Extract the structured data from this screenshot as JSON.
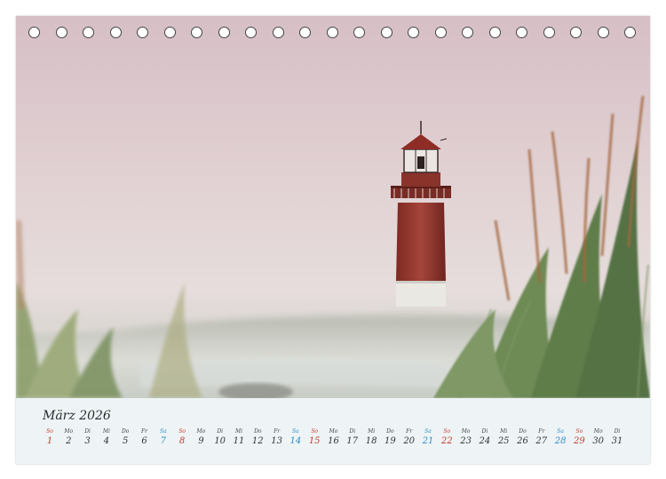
{
  "colors": {
    "saturday": "#2f8fc8",
    "sunday": "#c23a2e",
    "text": "#333333"
  },
  "calendar": {
    "title": "März 2026",
    "days": [
      {
        "wd": "So",
        "num": "1",
        "type": "so"
      },
      {
        "wd": "Mo",
        "num": "2",
        "type": "wk"
      },
      {
        "wd": "Di",
        "num": "3",
        "type": "wk"
      },
      {
        "wd": "Mi",
        "num": "4",
        "type": "wk"
      },
      {
        "wd": "Do",
        "num": "5",
        "type": "wk"
      },
      {
        "wd": "Fr",
        "num": "6",
        "type": "wk"
      },
      {
        "wd": "Sa",
        "num": "7",
        "type": "sa"
      },
      {
        "wd": "So",
        "num": "8",
        "type": "so"
      },
      {
        "wd": "Mo",
        "num": "9",
        "type": "wk"
      },
      {
        "wd": "Di",
        "num": "10",
        "type": "wk"
      },
      {
        "wd": "Mi",
        "num": "11",
        "type": "wk"
      },
      {
        "wd": "Do",
        "num": "12",
        "type": "wk"
      },
      {
        "wd": "Fr",
        "num": "13",
        "type": "wk"
      },
      {
        "wd": "Sa",
        "num": "14",
        "type": "sa"
      },
      {
        "wd": "So",
        "num": "15",
        "type": "so"
      },
      {
        "wd": "Mo",
        "num": "16",
        "type": "wk"
      },
      {
        "wd": "Di",
        "num": "17",
        "type": "wk"
      },
      {
        "wd": "Mi",
        "num": "18",
        "type": "wk"
      },
      {
        "wd": "Do",
        "num": "19",
        "type": "wk"
      },
      {
        "wd": "Fr",
        "num": "20",
        "type": "wk"
      },
      {
        "wd": "Sa",
        "num": "21",
        "type": "sa"
      },
      {
        "wd": "So",
        "num": "22",
        "type": "so"
      },
      {
        "wd": "Mo",
        "num": "23",
        "type": "wk"
      },
      {
        "wd": "Di",
        "num": "24",
        "type": "wk"
      },
      {
        "wd": "Mi",
        "num": "25",
        "type": "wk"
      },
      {
        "wd": "Do",
        "num": "26",
        "type": "wk"
      },
      {
        "wd": "Fr",
        "num": "27",
        "type": "wk"
      },
      {
        "wd": "Sa",
        "num": "28",
        "type": "sa"
      },
      {
        "wd": "So",
        "num": "29",
        "type": "so"
      },
      {
        "wd": "Mo",
        "num": "30",
        "type": "wk"
      },
      {
        "wd": "Di",
        "num": "31",
        "type": "wk"
      }
    ]
  },
  "photo": {
    "subject": "lighthouse-icon"
  }
}
